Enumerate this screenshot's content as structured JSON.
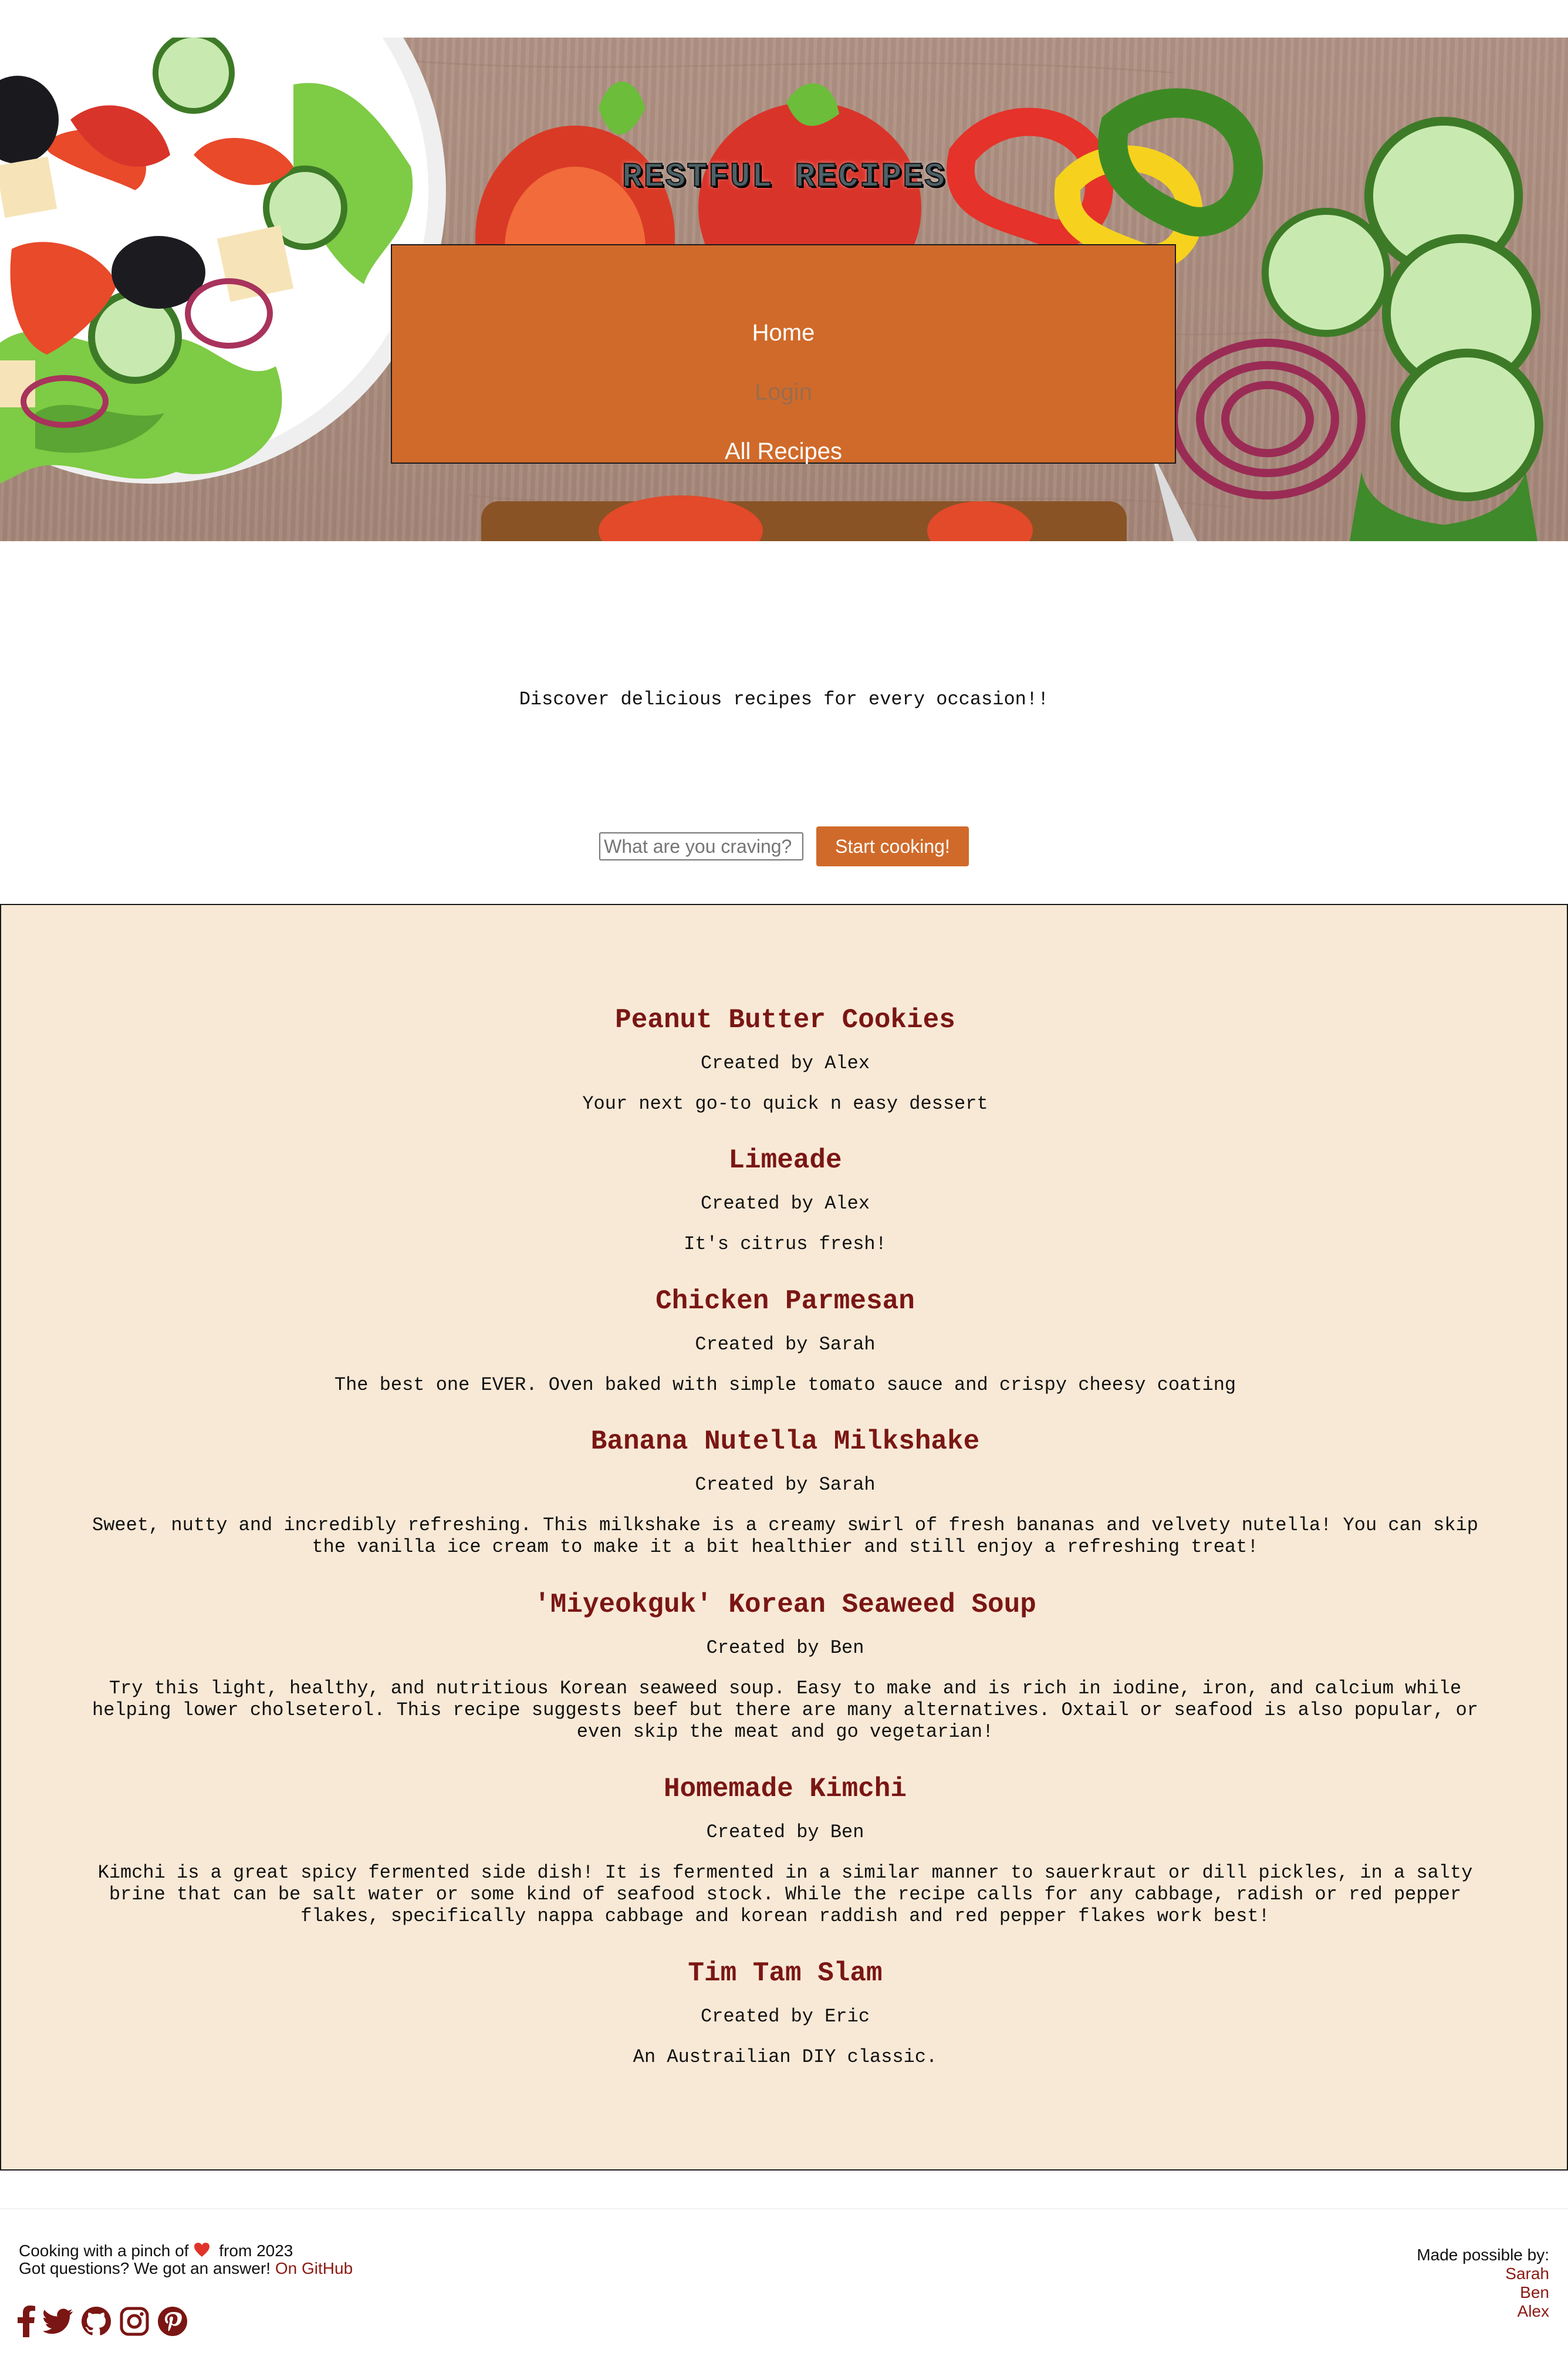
{
  "header": {
    "site_title": "RESTFUL RECIPES",
    "nav": [
      {
        "label": "Home"
      },
      {
        "label": "Login"
      },
      {
        "label": "All Recipes"
      }
    ]
  },
  "hero": {
    "tagline": "Discover delicious recipes for every occasion!!"
  },
  "search": {
    "placeholder": "What are you craving?",
    "button_label": "Start cooking!"
  },
  "recipes": [
    {
      "title": "Peanut Butter Cookies",
      "author": "Created by Alex",
      "description": "Your next go-to quick n easy dessert"
    },
    {
      "title": "Limeade",
      "author": "Created by Alex",
      "description": "It's citrus fresh!"
    },
    {
      "title": "Chicken Parmesan",
      "author": "Created by Sarah",
      "description": "The best one EVER. Oven baked with simple tomato sauce and crispy cheesy coating"
    },
    {
      "title": "Banana Nutella Milkshake",
      "author": "Created by Sarah",
      "description": "Sweet, nutty and incredibly refreshing. This milkshake is a creamy swirl of fresh bananas and velvety nutella! You can skip the vanilla ice cream to make it a bit healthier and still enjoy a refreshing treat!"
    },
    {
      "title": "'Miyeokguk' Korean Seaweed Soup",
      "author": "Created by Ben",
      "description": "Try this light, healthy, and nutritious Korean seaweed soup. Easy to make and is rich in iodine, iron, and calcium while helping lower cholseterol. This recipe suggests beef but there are many alternatives. Oxtail or seafood is also popular, or even skip the meat and go vegetarian!"
    },
    {
      "title": "Homemade Kimchi",
      "author": "Created by Ben",
      "description": "Kimchi is a great spicy fermented side dish! It is fermented in a similar manner to sauerkraut or dill pickles, in a salty brine that can be salt water or some kind of seafood stock. While the recipe calls for any cabbage, radish or red pepper flakes, specifically nappa cabbage and korean raddish and red pepper flakes work best!"
    },
    {
      "title": "Tim Tam Slam",
      "author": "Created by Eric",
      "description": "An Austrailian DIY classic."
    }
  ],
  "footer": {
    "line1_prefix": "Cooking with a pinch of",
    "line1_suffix": "from 2023",
    "line2_text": "Got questions? We got an answer!",
    "github_link": "On GitHub",
    "credits_label": "Made possible by:",
    "contributors": [
      "Sarah",
      "Ben",
      "Alex"
    ],
    "social_icons": [
      "facebook-icon",
      "twitter-icon",
      "github-icon",
      "instagram-icon",
      "pinterest-icon"
    ]
  },
  "colors": {
    "accent": "#d06a2a",
    "recipe_title": "#7a1614",
    "recipes_background": "#f8e9d6",
    "link": "#8b1a12"
  }
}
